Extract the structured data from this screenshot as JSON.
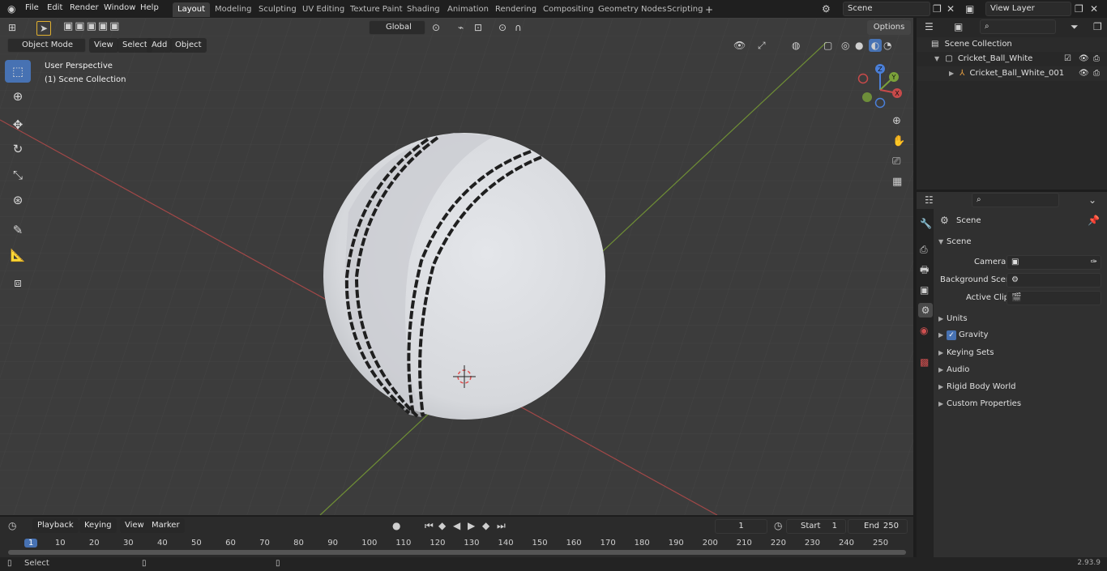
{
  "menu": [
    "File",
    "Edit",
    "Render",
    "Window",
    "Help"
  ],
  "workspaces": [
    "Layout",
    "Modeling",
    "Sculpting",
    "UV Editing",
    "Texture Paint",
    "Shading",
    "Animation",
    "Rendering",
    "Compositing",
    "Geometry Nodes",
    "Scripting"
  ],
  "active_workspace": "Layout",
  "scene_name": "Scene",
  "view_layer": "View Layer",
  "header": {
    "mode": "Object Mode",
    "view": "View",
    "select": "Select",
    "add": "Add",
    "object": "Object",
    "orientation": "Global",
    "options": "Options"
  },
  "viewport_overlay": {
    "perspective": "User Perspective",
    "collection": "(1) Scene Collection"
  },
  "gizmo": {
    "z": "Z",
    "y": "Y",
    "x": "X"
  },
  "outliner": {
    "root": "Scene Collection",
    "items": [
      {
        "name": "Cricket_Ball_White",
        "level": 1
      },
      {
        "name": "Cricket_Ball_White_001",
        "level": 2
      }
    ]
  },
  "properties": {
    "context": "Scene",
    "section": "Scene",
    "fields": [
      {
        "label": "Camera",
        "value": ""
      },
      {
        "label": "Background Scene",
        "value": ""
      },
      {
        "label": "Active Clip",
        "value": ""
      }
    ],
    "panels": [
      "Units",
      "Gravity",
      "Keying Sets",
      "Audio",
      "Rigid Body World",
      "Custom Properties"
    ],
    "gravity_checked": true
  },
  "timeline": {
    "playback": "Playback",
    "keying": "Keying",
    "view": "View",
    "marker": "Marker",
    "current_frame": "1",
    "start_label": "Start",
    "start": "1",
    "end_label": "End",
    "end": "250",
    "ticks": [
      "1",
      "10",
      "20",
      "30",
      "40",
      "50",
      "60",
      "70",
      "80",
      "90",
      "100",
      "110",
      "120",
      "130",
      "140",
      "150",
      "160",
      "170",
      "180",
      "190",
      "200",
      "210",
      "220",
      "230",
      "240",
      "250"
    ]
  },
  "status": {
    "left": "Select",
    "version": "2.93.9"
  },
  "colors": {
    "accent": "#4772b3",
    "x_axis": "#c84a4a",
    "y_axis": "#7ba23a",
    "viewport": "#3c3c3c"
  }
}
